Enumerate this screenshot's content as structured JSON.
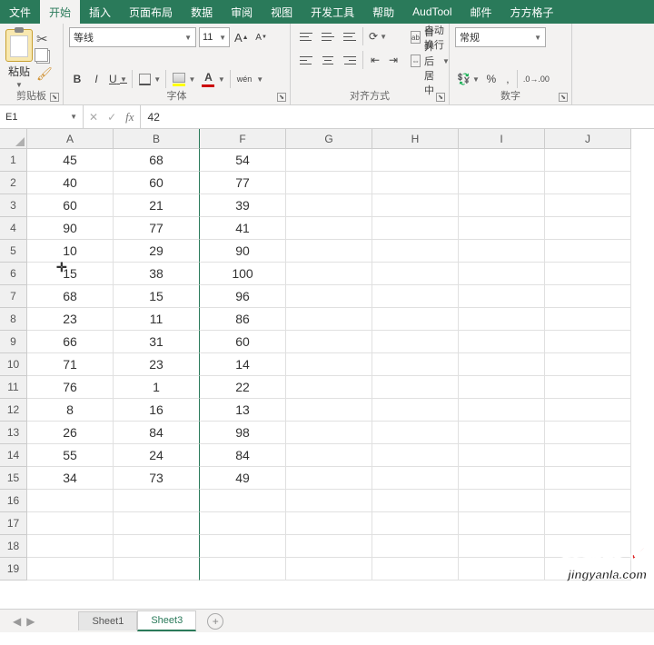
{
  "tabs": [
    "文件",
    "开始",
    "插入",
    "页面布局",
    "数据",
    "审阅",
    "视图",
    "开发工具",
    "帮助",
    "AudTool",
    "邮件",
    "方方格子"
  ],
  "active_tab_index": 1,
  "ribbon": {
    "clipboard": {
      "paste": "粘贴",
      "label": "剪贴板"
    },
    "font": {
      "name": "等线",
      "size": "11",
      "grow": "A",
      "sup": "▲",
      "shrink": "A",
      "sub": "▼",
      "bold": "B",
      "italic": "I",
      "underline": "U",
      "ruby": "wén",
      "label": "字体"
    },
    "align": {
      "wrap": "自动换行",
      "merge": "合并后居中",
      "label": "对齐方式"
    },
    "number": {
      "format": "常规",
      "label": "数字"
    }
  },
  "name_box": "E1",
  "formula_value": "42",
  "columns": [
    "A",
    "B",
    "F",
    "G",
    "H",
    "I",
    "J"
  ],
  "row_numbers": [
    1,
    2,
    3,
    4,
    5,
    6,
    7,
    8,
    9,
    10,
    11,
    12,
    13,
    14,
    15,
    16,
    17,
    18,
    19
  ],
  "grid": [
    [
      45,
      68,
      54,
      "",
      "",
      "",
      ""
    ],
    [
      40,
      60,
      77,
      "",
      "",
      "",
      ""
    ],
    [
      60,
      21,
      39,
      "",
      "",
      "",
      ""
    ],
    [
      90,
      77,
      41,
      "",
      "",
      "",
      ""
    ],
    [
      10,
      29,
      90,
      "",
      "",
      "",
      ""
    ],
    [
      15,
      38,
      100,
      "",
      "",
      "",
      ""
    ],
    [
      68,
      15,
      96,
      "",
      "",
      "",
      ""
    ],
    [
      23,
      11,
      86,
      "",
      "",
      "",
      ""
    ],
    [
      66,
      31,
      60,
      "",
      "",
      "",
      ""
    ],
    [
      71,
      23,
      14,
      "",
      "",
      "",
      ""
    ],
    [
      76,
      1,
      22,
      "",
      "",
      "",
      ""
    ],
    [
      8,
      16,
      13,
      "",
      "",
      "",
      ""
    ],
    [
      26,
      84,
      98,
      "",
      "",
      "",
      ""
    ],
    [
      55,
      24,
      84,
      "",
      "",
      "",
      ""
    ],
    [
      34,
      73,
      49,
      "",
      "",
      "",
      ""
    ],
    [
      "",
      "",
      "",
      "",
      "",
      "",
      ""
    ],
    [
      "",
      "",
      "",
      "",
      "",
      "",
      ""
    ],
    [
      "",
      "",
      "",
      "",
      "",
      "",
      ""
    ],
    [
      "",
      "",
      "",
      "",
      "",
      "",
      ""
    ]
  ],
  "sheets": [
    "Sheet1",
    "Sheet3"
  ],
  "active_sheet_index": 1,
  "watermark": {
    "title": "经验啦",
    "url": "jingyanla.com"
  }
}
